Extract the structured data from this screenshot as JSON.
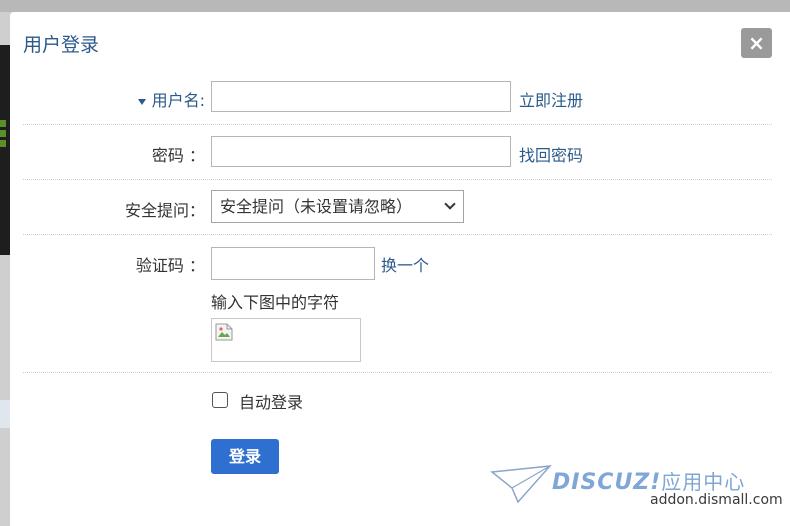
{
  "dialog": {
    "title": "用户登录",
    "close_label": "×"
  },
  "form": {
    "username": {
      "label": "用户名:",
      "value": "",
      "link": "立即注册"
    },
    "password": {
      "label": "密码 ：",
      "value": "",
      "link": "找回密码"
    },
    "security_question": {
      "label": "安全提问：",
      "selected": "安全提问（未设置请忽略）"
    },
    "captcha": {
      "label": "验证码 ：",
      "value": "",
      "link": "换一个",
      "hint": "输入下图中的字符"
    },
    "auto_login": {
      "label": "自动登录",
      "checked": false
    },
    "submit_label": "登录"
  },
  "watermark": {
    "logo_text": "DISCUZ!",
    "logo_cn": "应用中心",
    "url": "addon.dismall.com"
  }
}
